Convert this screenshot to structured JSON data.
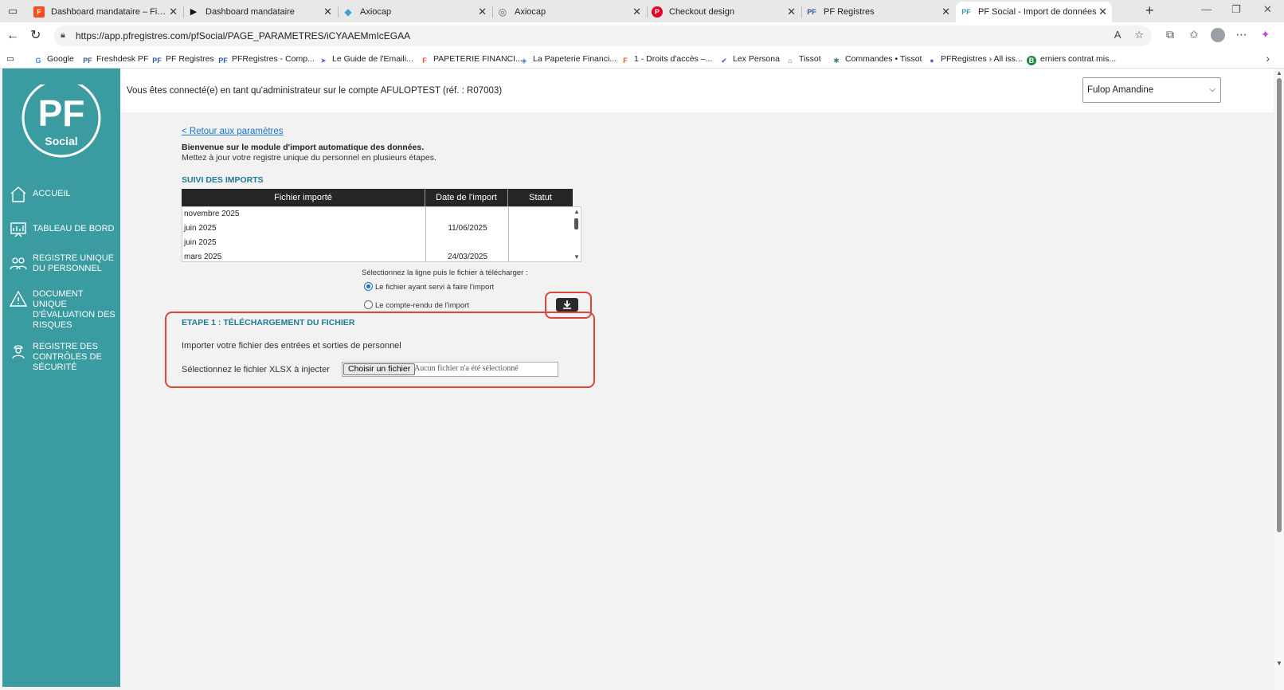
{
  "browser": {
    "tabs": [
      {
        "label": "Dashboard mandataire – Figma",
        "icon": "figma-icon"
      },
      {
        "label": "Dashboard mandataire",
        "icon": "play-icon"
      },
      {
        "label": "Axiocap",
        "icon": "axiocap-icon"
      },
      {
        "label": "Axiocap",
        "icon": "globe-icon"
      },
      {
        "label": "Checkout design",
        "icon": "pinterest-icon"
      },
      {
        "label": "PF Registres",
        "icon": "pf-icon"
      },
      {
        "label": "PF Social - Import de données",
        "icon": "pf-icon"
      }
    ],
    "url": "https://app.pfregistres.com/pfSocial/PAGE_PARAMETRES/iCYAAEMmIcEGAA",
    "bookmarks": [
      {
        "label": "Google",
        "icon": "google-icon"
      },
      {
        "label": "Freshdesk PF",
        "icon": "pf-icon"
      },
      {
        "label": "PF Registres",
        "icon": "pf-icon"
      },
      {
        "label": "PFRegistres - Comp...",
        "icon": "pf-icon"
      },
      {
        "label": "Le Guide de l'Emaili...",
        "icon": "send-icon"
      },
      {
        "label": "PAPETERIE FINANCI...",
        "icon": "figma-icon"
      },
      {
        "label": "La Papeterie Financi...",
        "icon": "diamond-icon"
      },
      {
        "label": "1 - Droits d'accès –...",
        "icon": "figma-icon"
      },
      {
        "label": "Lex Persona",
        "icon": "check-icon"
      },
      {
        "label": "Tissot",
        "icon": "home-icon"
      },
      {
        "label": "Commandes • Tissot",
        "icon": "leaf-icon"
      },
      {
        "label": "PFRegistres › All iss...",
        "icon": "circle-icon"
      },
      {
        "label": "erniers contrat mis...",
        "icon": "b-icon"
      }
    ]
  },
  "sidebar": {
    "logo_text": "PF",
    "logo_subtext": "Social",
    "items": [
      {
        "label": "ACCUEIL",
        "icon": "home-icon"
      },
      {
        "label": "TABLEAU DE BORD",
        "icon": "dashboard-icon"
      },
      {
        "label": "REGISTRE UNIQUE DU PERSONNEL",
        "icon": "people-icon"
      },
      {
        "label": "DOCUMENT UNIQUE D'ÉVALUATION DES RISQUES",
        "icon": "warning-icon"
      },
      {
        "label": "REGISTRE DES CONTRÔLES DE SÉCURITÉ",
        "icon": "worker-icon"
      }
    ]
  },
  "header": {
    "connection_text": "Vous êtes connecté(e) en tant qu'administrateur sur le compte AFULOPTEST (réf. : R07003)",
    "user_select_value": "Fulop Amandine"
  },
  "main": {
    "back_link": "< Retour aux paramètres",
    "welcome_title": "Bienvenue sur le module d'import automatique des données.",
    "welcome_text": "Mettez à jour votre registre unique du personnel en plusieurs étapes.",
    "imports_title": "SUIVI DES IMPORTS",
    "table": {
      "columns": [
        "Fichier importé",
        "Date de l'import",
        "Statut"
      ],
      "rows": [
        {
          "file": "novembre 2025",
          "date": "",
          "status": ""
        },
        {
          "file": "juin 2025",
          "date": "11/06/2025",
          "status": ""
        },
        {
          "file": "juin 2025",
          "date": "",
          "status": ""
        },
        {
          "file": "mars 2025",
          "date": "24/03/2025",
          "status": ""
        }
      ]
    },
    "download_hint": "Sélectionnez la ligne puis le fichier à télécharger :",
    "radio_options": [
      {
        "label": "Le fichier ayant servi à faire l'import",
        "selected": true
      },
      {
        "label": "Le compte-rendu de l'import",
        "selected": false
      }
    ],
    "step1_title": "ETAPE 1 : TÉLÉCHARGEMENT DU FICHIER",
    "step1_text": "Importer votre fichier des entrées et sorties de personnel",
    "file_label": "Sélectionnez le fichier XLSX à injecter",
    "file_button": "Choisir un fichier",
    "file_status": "Aucun fichier n'a été sélectionné"
  },
  "colors": {
    "sidebar": "#3a9ba0",
    "section_title": "#1f7a93",
    "link": "#1a73c7",
    "highlight": "#d9463a"
  }
}
